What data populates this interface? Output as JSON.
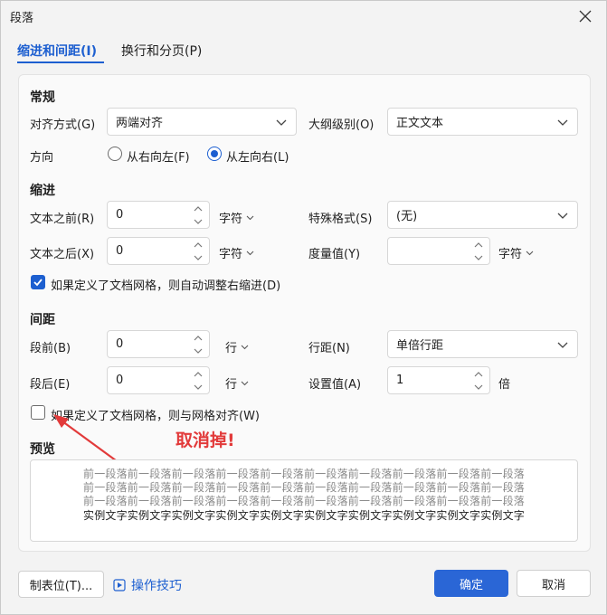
{
  "dialog": {
    "title": "段落"
  },
  "tabs": [
    {
      "label": "缩进和间距(I)"
    },
    {
      "label": "换行和分页(P)"
    }
  ],
  "general": {
    "heading": "常规",
    "alignment_label": "对齐方式(G)",
    "alignment_value": "两端对齐",
    "outline_label": "大纲级别(O)",
    "outline_value": "正文文本",
    "direction_label": "方向",
    "rtl_label": "从右向左(F)",
    "ltr_label": "从左向右(L)"
  },
  "indent": {
    "heading": "缩进",
    "before_label": "文本之前(R)",
    "before_value": "0",
    "before_unit": "字符",
    "special_label": "特殊格式(S)",
    "special_value": "(无)",
    "after_label": "文本之后(X)",
    "after_value": "0",
    "after_unit": "字符",
    "measure_label": "度量值(Y)",
    "measure_value": "",
    "measure_unit": "字符",
    "auto_adjust_label": "如果定义了文档网格，则自动调整右缩进(D)"
  },
  "spacing": {
    "heading": "间距",
    "before_label": "段前(B)",
    "before_value": "0",
    "before_unit": "行",
    "line_label": "行距(N)",
    "line_value": "单倍行距",
    "after_label": "段后(E)",
    "after_value": "0",
    "after_unit": "行",
    "setting_label": "设置值(A)",
    "setting_value": "1",
    "setting_unit": "倍",
    "snap_grid_label": "如果定义了文档网格，则与网格对齐(W)"
  },
  "annotation": "取消掉!",
  "preview": {
    "heading": "预览",
    "prev_lines": [
      "前一段落前一段落前一段落前一段落前一段落前一段落前一段落前一段落前一段落前一段落",
      "前一段落前一段落前一段落前一段落前一段落前一段落前一段落前一段落前一段落前一段落",
      "前一段落前一段落前一段落前一段落前一段落前一段落前一段落前一段落前一段落前一段落"
    ],
    "sample_line": "实例文字实例文字实例文字实例文字实例文字实例文字实例文字实例文字实例文字实例文字"
  },
  "footer": {
    "tabs_button": "制表位(T)...",
    "tips_link": "操作技巧",
    "ok_button": "确定",
    "cancel_button": "取消"
  },
  "colors": {
    "accent": "#1d5fd0",
    "annotation": "#e23a3a"
  }
}
